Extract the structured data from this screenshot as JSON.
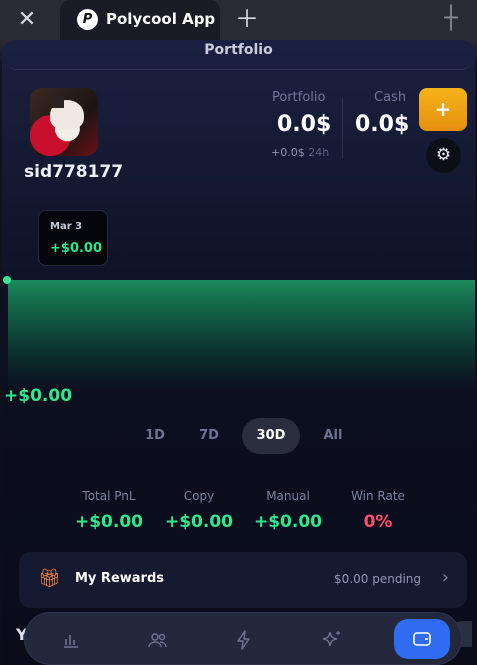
{
  "browser": {
    "close_icon": "close-icon",
    "tab_title": "Polycool App",
    "tab_logo_text": "P",
    "new_tab_icon": "plus-icon",
    "expand_icon": "expand-icon"
  },
  "header": {
    "title": "Portfolio"
  },
  "profile": {
    "username": "sid778177"
  },
  "stats": {
    "portfolio_label": "Portfolio",
    "portfolio_value": "0.0$",
    "portfolio_change": "+0.0$",
    "portfolio_period": "24h",
    "cash_label": "Cash",
    "cash_value": "0.0$",
    "add_label": "+"
  },
  "tooltip": {
    "date": "Mar 3",
    "value": "+$0.00"
  },
  "chart_data": {
    "type": "area",
    "x": [
      "Mar 3"
    ],
    "values": [
      0.0
    ],
    "current_value_label": "+$0.00",
    "color": "#2ee88c"
  },
  "ranges": [
    {
      "label": "1D",
      "active": false
    },
    {
      "label": "7D",
      "active": false
    },
    {
      "label": "30D",
      "active": true
    },
    {
      "label": "All",
      "active": false
    }
  ],
  "metrics": [
    {
      "label": "Total PnL",
      "value": "+$0.00"
    },
    {
      "label": "Copy",
      "value": "+$0.00"
    },
    {
      "label": "Manual",
      "value": "+$0.00"
    },
    {
      "label": "Win Rate",
      "value": "0%"
    }
  ],
  "rewards": {
    "title": "My Rewards",
    "pending": "$0.00 pending"
  },
  "nav": {
    "items": [
      "chart-icon",
      "users-icon",
      "lightning-icon",
      "sparkle-icon",
      "wallet-icon"
    ],
    "active": "wallet-icon"
  },
  "colors": {
    "accent": "#2f6cf2",
    "positive": "#2ee88c",
    "negative": "#ff4d6d",
    "cta": "#f6b31a"
  }
}
